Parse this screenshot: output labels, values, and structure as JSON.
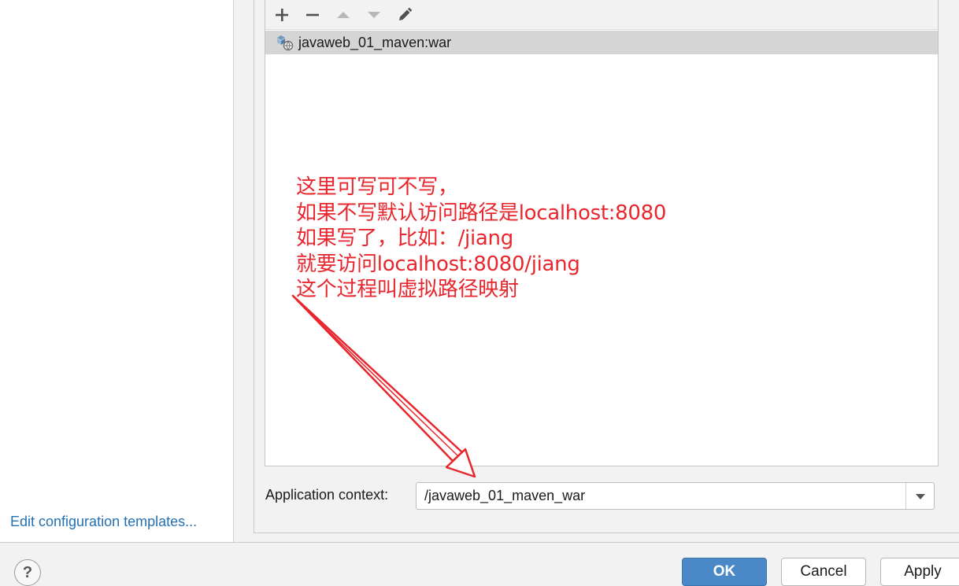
{
  "sidebar": {
    "edit_templates_link": "Edit configuration templates..."
  },
  "toolbar": {
    "icons": [
      "add-icon",
      "remove-icon",
      "move-up-icon",
      "move-down-icon",
      "edit-icon"
    ]
  },
  "artifacts": {
    "items": [
      {
        "label": "javaweb_01_maven:war",
        "icon": "war-artifact-icon",
        "selected": true
      }
    ]
  },
  "annotation": {
    "lines": [
      "这里可写可不写，",
      "如果不写默认访问路径是localhost:8080",
      "如果写了，比如：/jiang",
      "就要访问localhost:8080/jiang",
      "这个过程叫虚拟路径映射"
    ],
    "color": "#e8262d"
  },
  "application_context": {
    "label": "Application context:",
    "value": "/javaweb_01_maven_war"
  },
  "footer": {
    "help_label": "?",
    "ok_label": "OK",
    "cancel_label": "Cancel",
    "apply_label": "Apply"
  },
  "colors": {
    "accent": "#4a88c7",
    "link": "#2470b3",
    "selection": "#d5d5d5"
  }
}
